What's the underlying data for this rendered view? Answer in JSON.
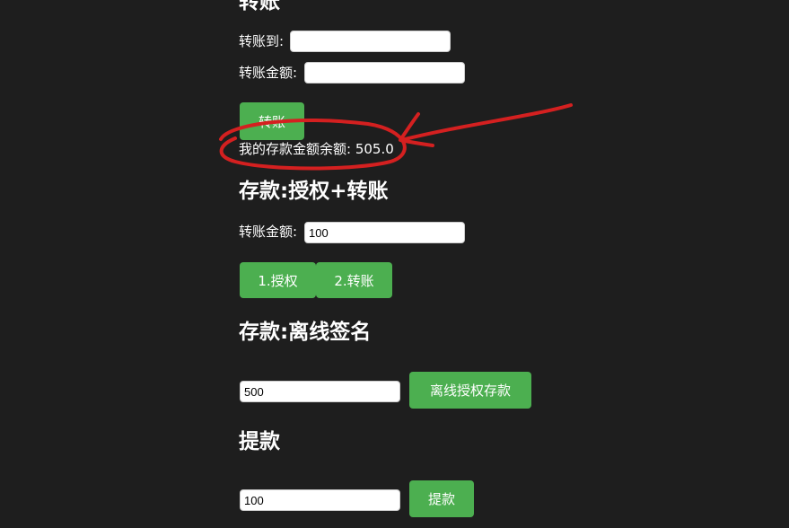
{
  "transfer": {
    "title": "转账",
    "to_label": "转账到:",
    "to_value": "",
    "amount_label": "转账金额:",
    "amount_value": "",
    "button": "转账",
    "balance_label": "我的存款金额余额:",
    "balance_value": "505.0"
  },
  "deposit_approve": {
    "title": "存款:授权+转账",
    "amount_label": "转账金额:",
    "amount_value": "100",
    "approve_button": "1.授权",
    "transfer_button": "2.转账"
  },
  "deposit_offline": {
    "title": "存款:离线签名",
    "amount_value": "500",
    "button": "离线授权存款"
  },
  "withdraw": {
    "title": "提款",
    "amount_value": "100",
    "button": "提款"
  },
  "colors": {
    "background": "#1e1e1e",
    "button": "#4caf50",
    "annotation": "#d42020"
  }
}
